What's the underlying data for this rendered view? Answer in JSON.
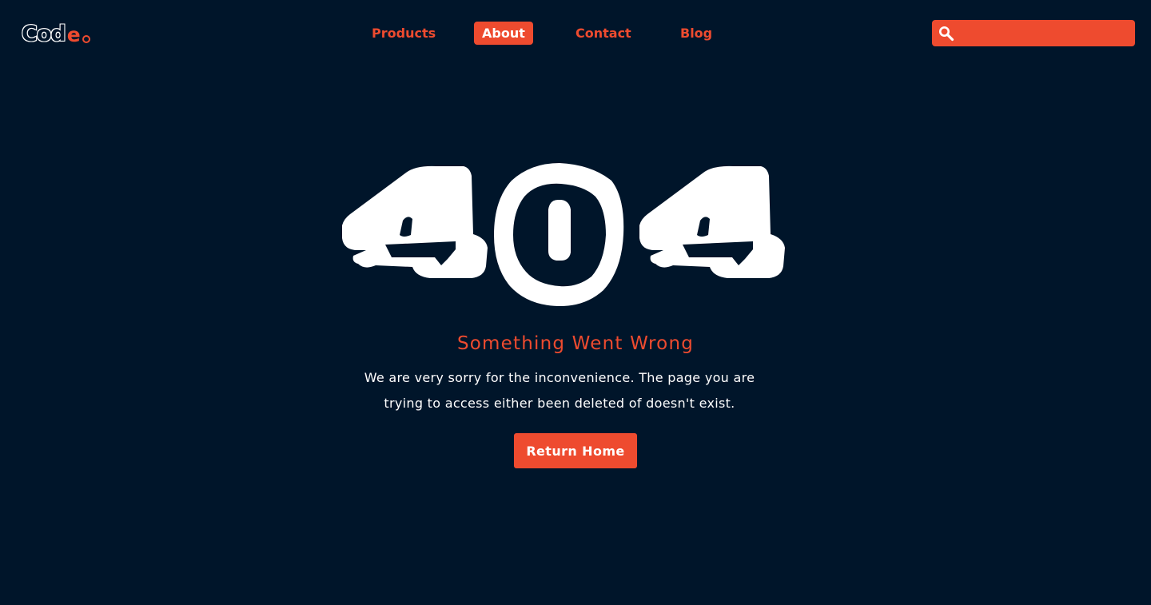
{
  "logo": {
    "main": "Cod",
    "accent": "e"
  },
  "nav": {
    "items": [
      {
        "label": "Products"
      },
      {
        "label": "About"
      },
      {
        "label": "Contact"
      },
      {
        "label": "Blog"
      }
    ],
    "active": "About"
  },
  "search": {
    "placeholder": "",
    "value": "",
    "icon": "search-icon"
  },
  "error": {
    "code": "404",
    "heading": "Something Went Wrong",
    "message": "We are very sorry for the inconvenience. The page you are trying to access either been deleted of doesn't exist.",
    "button_label": "Return Home"
  },
  "colors": {
    "background": "#00152a",
    "accent": "#ee4b2f",
    "text": "#ffffff"
  }
}
